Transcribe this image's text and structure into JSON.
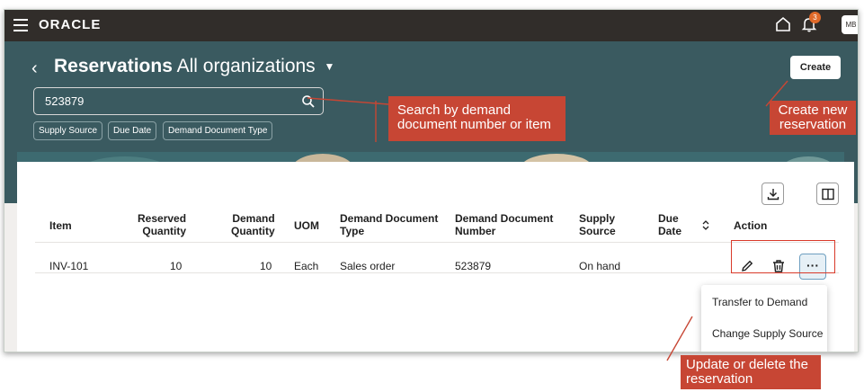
{
  "header": {
    "logo": "ORACLE",
    "notification_count": "3",
    "avatar_initials": "MB"
  },
  "page": {
    "title_bold": "Reservations",
    "title_rest": "All organizations",
    "create_label": "Create"
  },
  "search": {
    "value": "523879"
  },
  "filters": [
    "Supply Source",
    "Due Date",
    "Demand Document Type"
  ],
  "table": {
    "headers": {
      "item": "Item",
      "reserved_quantity_1": "Reserved",
      "reserved_quantity_2": "Quantity",
      "demand_quantity_1": "Demand",
      "demand_quantity_2": "Quantity",
      "uom": "UOM",
      "demand_document_type_1": "Demand Document",
      "demand_document_type_2": "Type",
      "demand_document_number_1": "Demand Document",
      "demand_document_number_2": "Number",
      "supply_source_1": "Supply",
      "supply_source_2": "Source",
      "due_date_1": "Due",
      "due_date_2": "Date",
      "action": "Action"
    },
    "rows": [
      {
        "item": "INV-101",
        "reserved_quantity": "10",
        "demand_quantity": "10",
        "uom": "Each",
        "demand_document_type": "Sales order",
        "demand_document_number": "523879",
        "supply_source": "On hand",
        "due_date": ""
      }
    ]
  },
  "actions_menu": [
    "Transfer to Demand",
    "Change Supply Source"
  ],
  "callouts": {
    "search_1": "Search by demand",
    "search_2": "document number or item",
    "create_1": "Create  new",
    "create_2": "reservation",
    "update_1": "Update or delete the",
    "update_2": "reservation"
  },
  "colors": {
    "topbar": "#312d2a",
    "hero": "#3a5a60",
    "callout": "#c74634"
  }
}
